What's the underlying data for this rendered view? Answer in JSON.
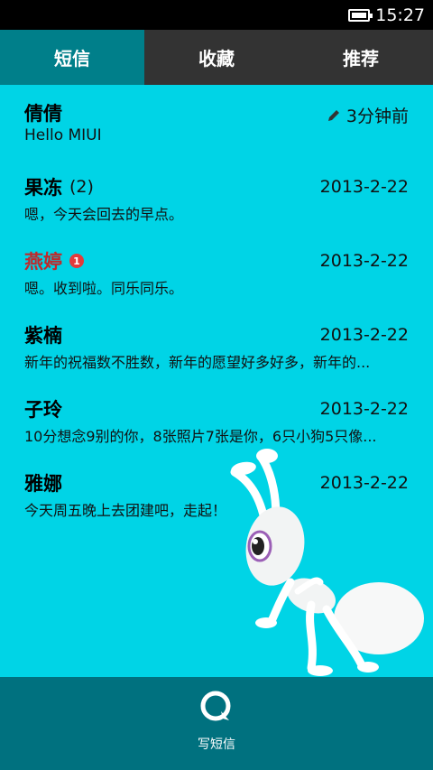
{
  "status_bar": {
    "time": "15:27",
    "battery_icon": "battery-full-icon"
  },
  "tabs": [
    {
      "label": "短信",
      "active": true
    },
    {
      "label": "收藏",
      "active": false
    },
    {
      "label": "推荐",
      "active": false
    }
  ],
  "messages": [
    {
      "name": "倩倩",
      "count": "",
      "unread_badge": "",
      "date": "3分钟前",
      "draft_icon": "pencil-icon",
      "preview": "Hello MIUI"
    },
    {
      "name": "果冻",
      "count": "(2)",
      "unread_badge": "",
      "date": "2013-2-22",
      "preview": "嗯，今天会回去的早点。"
    },
    {
      "name": "燕婷",
      "count": "",
      "unread_badge": "1",
      "date": "2013-2-22",
      "preview": "嗯。收到啦。同乐同乐。"
    },
    {
      "name": "紫楠",
      "count": "",
      "unread_badge": "",
      "date": "2013-2-22",
      "preview": "新年的祝福数不胜数，新年的愿望好多好多，新年的..."
    },
    {
      "name": "子玲",
      "count": "",
      "unread_badge": "",
      "date": "2013-2-22",
      "preview": "10分想念9别的你，8张照片7张是你，6只小狗5只像..."
    },
    {
      "name": "雅娜",
      "count": "",
      "unread_badge": "",
      "date": "2013-2-22",
      "preview": "今天周五晚上去团建吧，走起！"
    }
  ],
  "bottom_bar": {
    "compose_label": "写短信",
    "compose_icon": "compose-message-icon"
  },
  "colors": {
    "background": "#00d4e6",
    "tab_active": "#007f8a",
    "tab_inactive": "#333333",
    "bottom_bar": "#00717f",
    "unread_name": "#c0282a"
  }
}
